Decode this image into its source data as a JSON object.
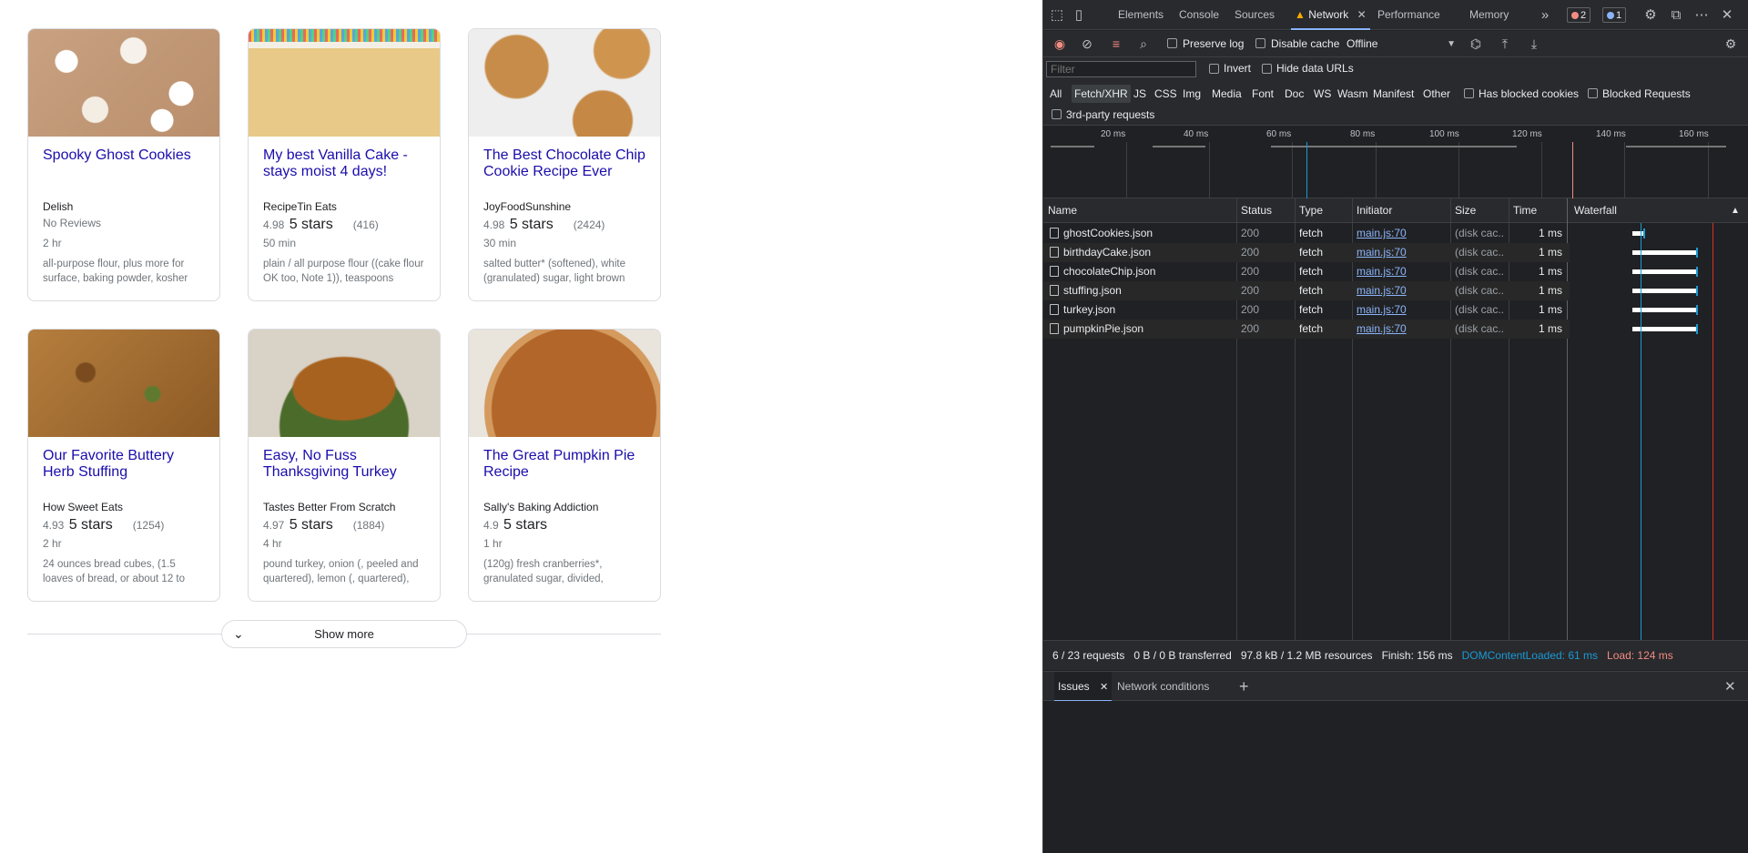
{
  "recipes": [
    {
      "title": "Spooky Ghost Cookies",
      "source": "Delish",
      "rating": "No Reviews",
      "stars": "",
      "count": "",
      "time": "2 hr",
      "ingredients": "all-purpose flour, plus more for surface, baking powder, kosher",
      "image": "ghost-cookies-image"
    },
    {
      "title": "My best Vanilla Cake - stays moist 4 days!",
      "source": "RecipeTin Eats",
      "rating": "4.98",
      "stars": "5 stars",
      "count": "(416)",
      "time": "50 min",
      "ingredients": "plain / all purpose flour ((cake flour OK too, Note 1)), teaspoons",
      "image": "vanilla-cake-image"
    },
    {
      "title": "The Best Chocolate Chip Cookie Recipe Ever",
      "source": "JoyFoodSunshine",
      "rating": "4.98",
      "stars": "5 stars",
      "count": "(2424)",
      "time": "30 min",
      "ingredients": "salted butter* (softened), white (granulated) sugar, light brown",
      "image": "chocolate-chip-cookie-image"
    },
    {
      "title": "Our Favorite Buttery Herb Stuffing",
      "source": "How Sweet Eats",
      "rating": "4.93",
      "stars": "5 stars",
      "count": "(1254)",
      "time": "2 hr",
      "ingredients": "24 ounces bread cubes, (1.5 loaves of bread, or about 12 to",
      "image": "herb-stuffing-image"
    },
    {
      "title": "Easy, No Fuss Thanksgiving Turkey",
      "source": "Tastes Better From Scratch",
      "rating": "4.97",
      "stars": "5 stars",
      "count": "(1884)",
      "time": "4 hr",
      "ingredients": "pound turkey, onion (, peeled and quartered), lemon (, quartered),",
      "image": "turkey-image"
    },
    {
      "title": "The Great Pumpkin Pie Recipe",
      "source": "Sally's Baking Addiction",
      "rating": "4.9",
      "stars": "5 stars",
      "count": "",
      "time": "1 hr",
      "ingredients": "(120g) fresh cranberries*, granulated sugar, divided,",
      "image": "pumpkin-pie-image"
    }
  ],
  "show_more_label": "Show more",
  "devtools": {
    "tabs": [
      "Elements",
      "Console",
      "Sources",
      "Network",
      "Performance",
      "Memory"
    ],
    "active_tab": "Network",
    "error_count": "2",
    "info_count": "1",
    "toolbar": {
      "preserve_log": "Preserve log",
      "disable_cache": "Disable cache",
      "throttling": "Offline"
    },
    "filter": {
      "placeholder": "Filter",
      "invert": "Invert",
      "hide_data_urls": "Hide data URLs",
      "types": [
        "All",
        "Fetch/XHR",
        "JS",
        "CSS",
        "Img",
        "Media",
        "Font",
        "Doc",
        "WS",
        "Wasm",
        "Manifest",
        "Other"
      ],
      "active_type": "Fetch/XHR",
      "has_blocked_cookies": "Has blocked cookies",
      "blocked_requests": "Blocked Requests",
      "third_party": "3rd-party requests"
    },
    "timeline_ticks": [
      "20 ms",
      "40 ms",
      "60 ms",
      "80 ms",
      "100 ms",
      "120 ms",
      "140 ms",
      "160 ms"
    ],
    "columns": [
      "Name",
      "Status",
      "Type",
      "Initiator",
      "Size",
      "Time",
      "Waterfall"
    ],
    "requests": [
      {
        "name": "ghostCookies.json",
        "status": "200",
        "type": "fetch",
        "initiator": "main.js:70",
        "size": "(disk cac...",
        "time": "1 ms"
      },
      {
        "name": "birthdayCake.json",
        "status": "200",
        "type": "fetch",
        "initiator": "main.js:70",
        "size": "(disk cac...",
        "time": "1 ms"
      },
      {
        "name": "chocolateChip.json",
        "status": "200",
        "type": "fetch",
        "initiator": "main.js:70",
        "size": "(disk cac...",
        "time": "1 ms"
      },
      {
        "name": "stuffing.json",
        "status": "200",
        "type": "fetch",
        "initiator": "main.js:70",
        "size": "(disk cac...",
        "time": "1 ms"
      },
      {
        "name": "turkey.json",
        "status": "200",
        "type": "fetch",
        "initiator": "main.js:70",
        "size": "(disk cac...",
        "time": "1 ms"
      },
      {
        "name": "pumpkinPie.json",
        "status": "200",
        "type": "fetch",
        "initiator": "main.js:70",
        "size": "(disk cac...",
        "time": "1 ms"
      }
    ],
    "summary": {
      "requests": "6 / 23 requests",
      "transferred": "0 B / 0 B transferred",
      "resources": "97.8 kB / 1.2 MB resources",
      "finish": "Finish: 156 ms",
      "dom_content_loaded": "DOMContentLoaded: 61 ms",
      "load": "Load: 124 ms"
    },
    "drawer": {
      "tabs": [
        "Issues",
        "Network conditions"
      ],
      "active": "Issues"
    }
  }
}
